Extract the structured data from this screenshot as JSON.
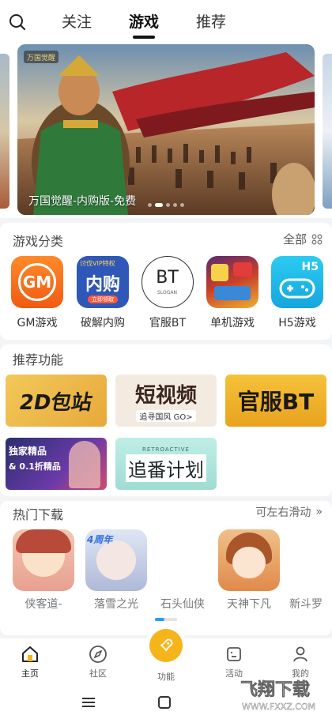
{
  "top_nav": {
    "tabs": [
      "关注",
      "游戏",
      "推荐"
    ],
    "active_tab": "游戏"
  },
  "banner": {
    "caption": "万国觉醒-内购版-免费",
    "logo_text": "万国觉醒",
    "slide_count": 5,
    "active_slide": 2
  },
  "categories": {
    "title": "游戏分类",
    "more_label": "全部",
    "items": [
      {
        "label": "GM游戏",
        "tile_text": "GM"
      },
      {
        "label": "破解内购",
        "tile_text": "内购",
        "tile_top": "讨伐VIP特权",
        "tile_bottom": "立即领取"
      },
      {
        "label": "官服BT",
        "tile_text": "BT",
        "tile_sub": "SLOGAN"
      },
      {
        "label": "单机游戏"
      },
      {
        "label": "H5游戏",
        "tile_text": "H5"
      }
    ]
  },
  "recommend": {
    "title": "推荐功能",
    "tiles": [
      {
        "text": "2D包站"
      },
      {
        "text": "短视频",
        "sub": "追寻国风 GO>"
      },
      {
        "text": "官服BT"
      },
      {
        "text": "独家精品",
        "sub": "& 0.1折精品"
      },
      {
        "text": "追番计划",
        "top": "RETROACTIVE"
      }
    ]
  },
  "hot": {
    "title": "热门下载",
    "more_label": "可左右滑动",
    "items": [
      {
        "label": "侠客道-"
      },
      {
        "label": "落雪之光",
        "badge": "4周年"
      },
      {
        "label": "石头仙侠"
      },
      {
        "label": "天神下凡"
      },
      {
        "label": "新斗罗"
      }
    ]
  },
  "tabbar": {
    "items": [
      {
        "label": "主页",
        "icon": "home-icon"
      },
      {
        "label": "社区",
        "icon": "compass-icon"
      },
      {
        "label": "功能",
        "icon": "rocket-icon"
      },
      {
        "label": "活动",
        "icon": "activity-icon"
      },
      {
        "label": "我的",
        "icon": "user-icon"
      }
    ]
  },
  "watermark": {
    "title": "飞翔下载",
    "url": "WWW.FXXZ.COM"
  },
  "colors": {
    "accent": "#f5b51a",
    "gm_orange": "#f26b1d",
    "h5_cyan": "#1fb8e8",
    "scroll_blue": "#2a9df4"
  }
}
